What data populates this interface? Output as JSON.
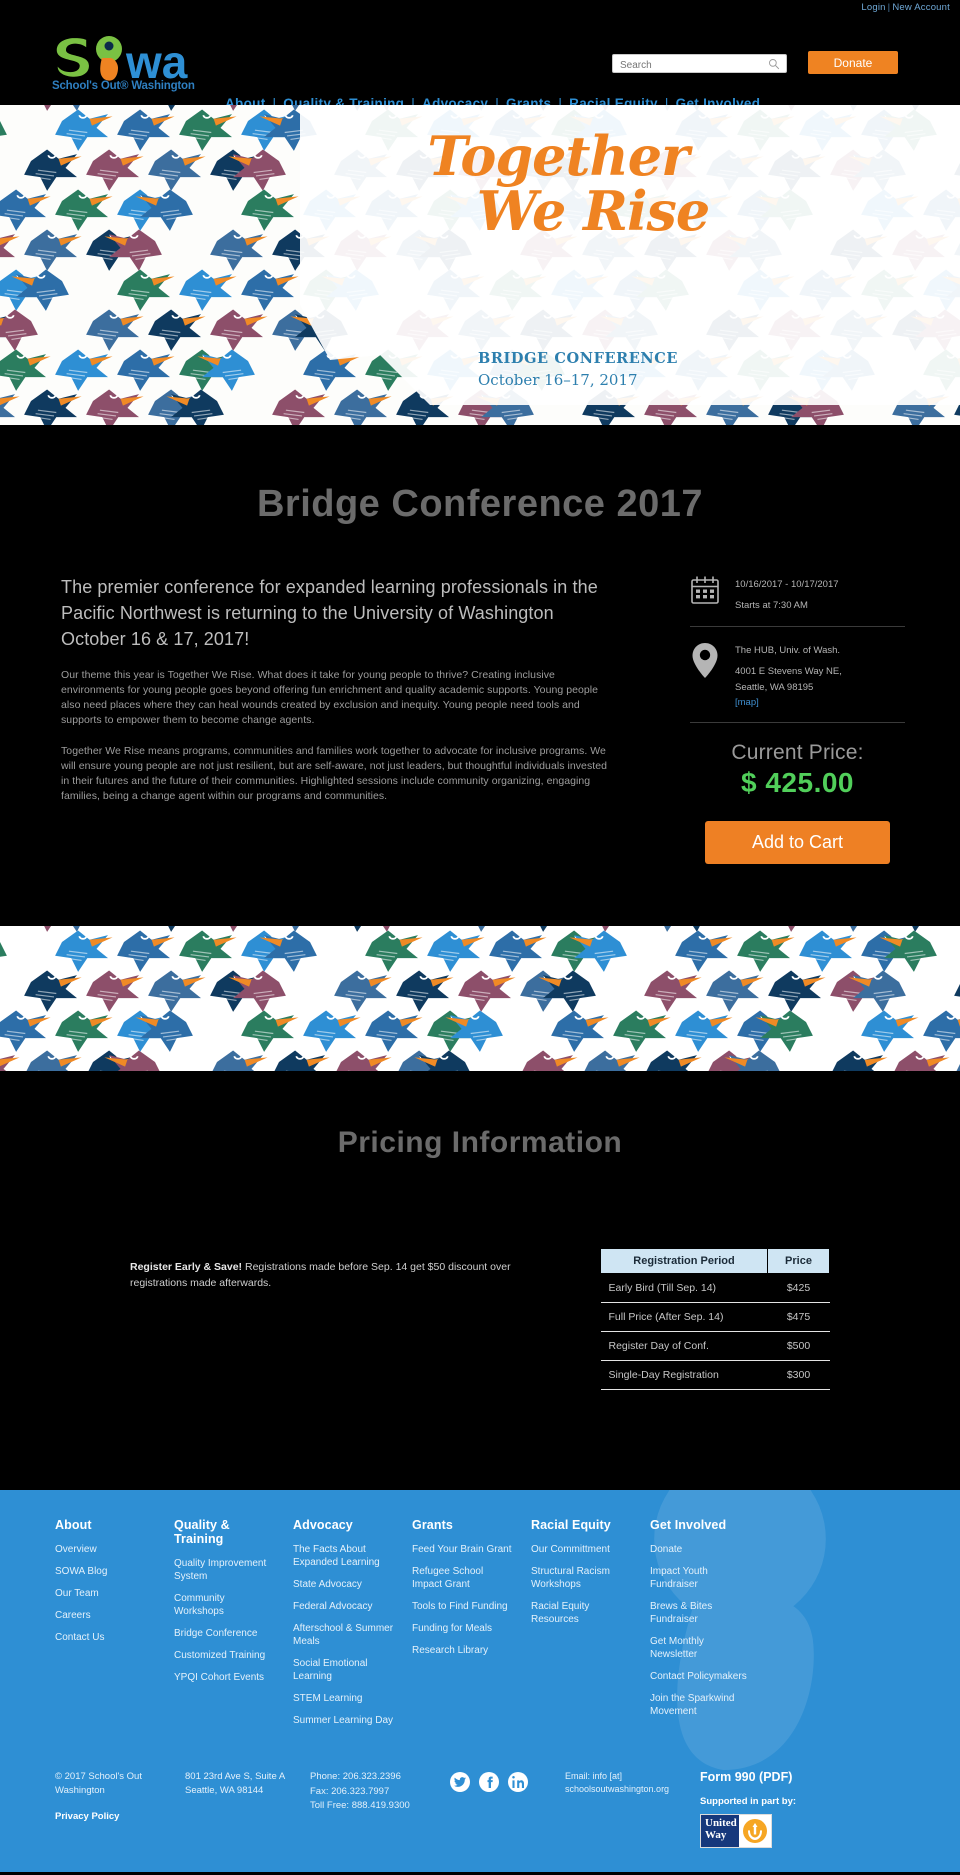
{
  "topbar": {
    "login": "Login",
    "separator": "|",
    "new_account": "New Account"
  },
  "header": {
    "logo_text": "sowa",
    "logo_tagline": "School's Out® Washington",
    "search_placeholder": "Search",
    "search_value": "",
    "donate_label": "Donate",
    "nav": [
      "About",
      "Quality & Training",
      "Advocacy",
      "Grants",
      "Racial Equity",
      "Get Involved"
    ],
    "nav_separator": "|"
  },
  "hero": {
    "title_line1": "Together",
    "title_line2": "We Rise",
    "subtitle": "BRIDGE CONFERENCE",
    "dates": "October 16–17, 2017"
  },
  "main": {
    "page_title": "Bridge Conference 2017",
    "lead": "The premier conference for expanded learning professionals in the Pacific Northwest is returning to the University of Washington October 16 & 17, 2017!",
    "paragraph1": "Our theme this year is Together We Rise. What does it take for young people to thrive? Creating inclusive environments for young people goes beyond offering fun enrichment and quality academic supports. Young people also need places where they can heal wounds created by exclusion and inequity. Young people need tools and supports to empower them to become change agents.",
    "paragraph2": "Together We Rise means programs, communities and families work together to advocate for inclusive programs. We will ensure young people are not just resilient, but are self-aware, not just leaders, but thoughtful individuals invested in their futures and the future of their communities. Highlighted sessions include community organizing, engaging families, being a change agent within our programs and communities."
  },
  "event": {
    "date_range": "10/16/2017 - 10/17/2017",
    "start_time": "Starts at 7:30 AM",
    "venue": "The HUB, Univ. of Wash.",
    "address_line1": "4001 E Stevens Way NE,",
    "address_line2": "Seattle, WA 98195",
    "map_label": "[map]",
    "price_label": "Current Price:",
    "price_value": "$ 425.00",
    "add_to_cart": "Add to Cart"
  },
  "pricing": {
    "heading": "Pricing Information",
    "note_bold": "Register Early & Save!",
    "note_rest": " Registrations made before Sep. 14 get $50 discount over registrations made afterwards.",
    "table": {
      "headers": [
        "Registration Period",
        "Price"
      ],
      "rows": [
        {
          "period": "Early Bird (Till Sep. 14)",
          "price": "$425"
        },
        {
          "period": "Full Price (After Sep. 14)",
          "price": "$475"
        },
        {
          "period": "Register Day of Conf.",
          "price": "$500"
        },
        {
          "period": "Single-Day Registration",
          "price": "$300"
        }
      ]
    }
  },
  "footer": {
    "columns": [
      {
        "title": "About",
        "links": [
          "Overview",
          "SOWA Blog",
          "Our Team",
          "Careers",
          "Contact Us"
        ]
      },
      {
        "title": "Quality & Training",
        "links": [
          "Quality Improvement System",
          "Community Workshops",
          "Bridge Conference",
          "Customized Training",
          "YPQI Cohort Events"
        ]
      },
      {
        "title": "Advocacy",
        "links": [
          "The Facts About Expanded Learning",
          "State Advocacy",
          "Federal Advocacy",
          "Afterschool & Summer Meals",
          "Social Emotional Learning",
          "STEM Learning",
          "Summer Learning Day"
        ]
      },
      {
        "title": "Grants",
        "links": [
          "Feed Your Brain Grant",
          "Refugee School Impact Grant",
          "Tools to Find Funding",
          "Funding for Meals",
          "Research Library"
        ]
      },
      {
        "title": "Racial Equity",
        "links": [
          "Our Committment",
          "Structural Racism Workshops",
          "Racial Equity Resources"
        ]
      },
      {
        "title": "Get Involved",
        "links": [
          "Donate",
          "Impact Youth Fundraiser",
          "Brews & Bites Fundraiser",
          "Get Monthly Newsletter",
          "Contact Policymakers",
          "Join the Sparkwind Movement"
        ]
      }
    ],
    "copyright": "© 2017 School's Out Washington",
    "privacy_policy": "Privacy Policy",
    "address_line1": "801 23rd Ave S, Suite A",
    "address_line2": "Seattle, WA 98144",
    "phone": "Phone: 206.323.2396",
    "fax": "Fax: 206.323.7997",
    "toll_free": "Toll Free: 888.419.9300",
    "email_line1": "Email: info [at]",
    "email_line2": "schoolsoutwashington.org",
    "form990": "Form 990 (PDF)",
    "supported_by": "Supported in part by:",
    "united_way_line1": "United",
    "united_way_line2": "Way"
  },
  "colors": {
    "brand_blue": "#2e8fd4",
    "brand_orange": "#ef8322",
    "brand_green": "#51cf5a",
    "logo_green": "#7ac143"
  }
}
